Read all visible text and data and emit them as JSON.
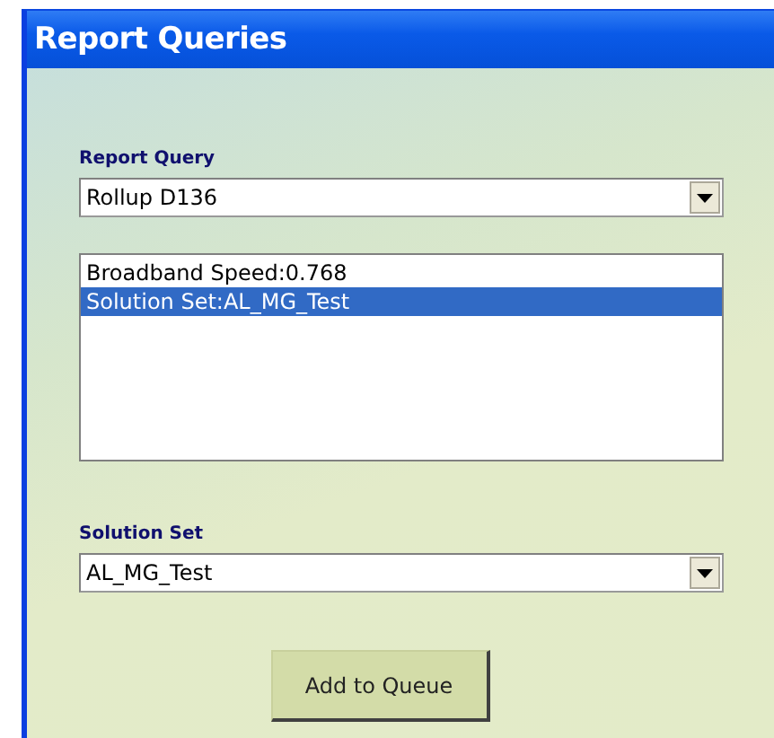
{
  "window": {
    "title": "Report Queries"
  },
  "report_query": {
    "label": "Report Query",
    "value": "Rollup D136"
  },
  "list": {
    "items": [
      {
        "text": "Broadband Speed:0.768",
        "selected": false
      },
      {
        "text": "Solution Set:AL_MG_Test",
        "selected": true
      }
    ]
  },
  "solution_set": {
    "label": "Solution Set",
    "value": "AL_MG_Test"
  },
  "buttons": [
    {
      "label": "Add to Queue"
    }
  ]
}
